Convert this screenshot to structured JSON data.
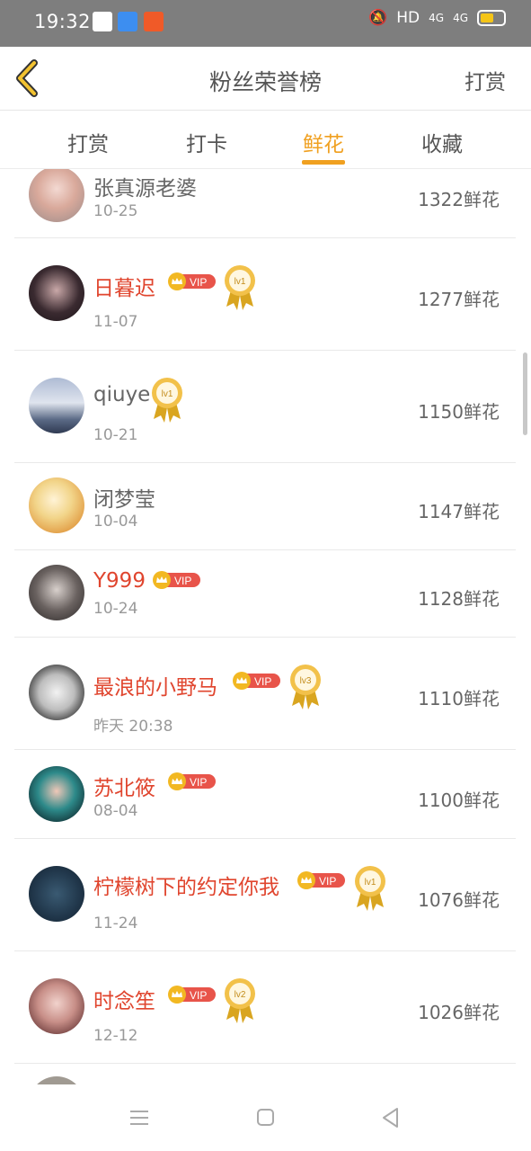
{
  "status_bar": {
    "time": "19:32",
    "network": "HD",
    "signal1": "4G",
    "signal2": "4G"
  },
  "header": {
    "title": "粉丝荣誉榜",
    "right_action": "打赏"
  },
  "tabs": [
    {
      "label": "打赏"
    },
    {
      "label": "打卡"
    },
    {
      "label": "鲜花",
      "active": true
    },
    {
      "label": "收藏"
    }
  ],
  "vip_text": "VIP",
  "list": [
    {
      "name": "张真源老婆",
      "date": "10-25",
      "score": "1322鲜花",
      "vip": false,
      "level": ""
    },
    {
      "name": "日暮迟",
      "date": "11-07",
      "score": "1277鲜花",
      "vip": true,
      "level": "lv1"
    },
    {
      "name": "qiuye",
      "date": "10-21",
      "score": "1150鲜花",
      "vip": false,
      "level": "lv1"
    },
    {
      "name": "闭梦莹",
      "date": "10-04",
      "score": "1147鲜花",
      "vip": false,
      "level": ""
    },
    {
      "name": "Y999",
      "date": "10-24",
      "score": "1128鲜花",
      "vip": true,
      "level": ""
    },
    {
      "name": "最浪的小野马",
      "date": "昨天 20:38",
      "score": "1110鲜花",
      "vip": true,
      "level": "lv3"
    },
    {
      "name": "苏北筱",
      "date": "08-04",
      "score": "1100鲜花",
      "vip": true,
      "level": ""
    },
    {
      "name": "柠檬树下的约定你我",
      "date": "11-24",
      "score": "1076鲜花",
      "vip": true,
      "level": "lv1"
    },
    {
      "name": "时念笙",
      "date": "12-12",
      "score": "1026鲜花",
      "vip": true,
      "level": "lv2"
    }
  ],
  "colors": {
    "accent": "#f0a020",
    "vip_name": "#e0452e",
    "vip_badge": "#e8544a",
    "crown": "#f2b822"
  },
  "icons": {
    "back": "chevron-left-icon",
    "nav_menu": "menu-icon",
    "nav_home": "square-icon",
    "nav_back": "triangle-back-icon"
  }
}
